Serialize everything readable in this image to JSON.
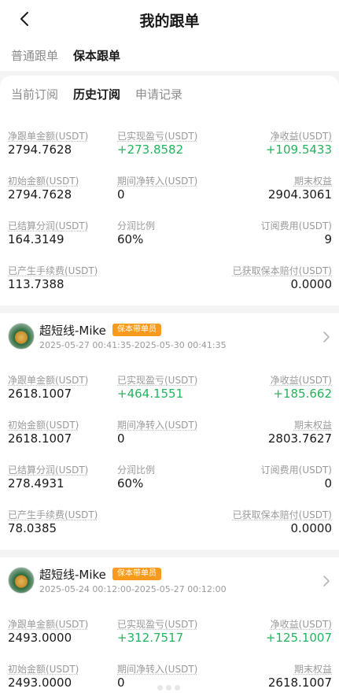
{
  "header": {
    "title": "我的跟单",
    "back_icon": "chevron-left-icon"
  },
  "segments": [
    "普通跟单",
    "保本跟单"
  ],
  "tabs": [
    "当前订阅",
    "历史订阅",
    "申请记录"
  ],
  "colors": {
    "green": "#23b45e",
    "badge": "#f79a1e"
  },
  "records": [
    {
      "stats": [
        [
          {
            "label": "净跟单金额(USDT)",
            "value": "2794.7628"
          },
          {
            "label": "已实现盈亏(USDT)",
            "value": "+273.8582"
          },
          {
            "label": "净收益(USDT)",
            "value": "+109.5433"
          }
        ],
        [
          {
            "label": "初始金额(USDT)",
            "value": "2794.7628"
          },
          {
            "label": "期间净转入(USDT)",
            "value": "0"
          },
          {
            "label": "期末权益",
            "value": "2904.3061"
          }
        ],
        [
          {
            "label": "已结算分润(USDT)",
            "value": "164.3149"
          },
          {
            "label": "分润比例",
            "value": "60%"
          },
          {
            "label": "订阅费用(USDT)",
            "value": "9"
          }
        ],
        [
          {
            "label": "已产生手续费(USDT)",
            "value": "113.7388"
          },
          {
            "label": "已获取保本赔付(USDT)",
            "value": "0.0000"
          }
        ]
      ]
    },
    {
      "trader": {
        "name": "超短线-Mike",
        "badge": "保本带单员",
        "time": "2025-05-27 00:41:35-2025-05-30 00:41:35"
      },
      "stats": [
        [
          {
            "label": "净跟单金额(USDT)",
            "value": "2618.1007"
          },
          {
            "label": "已实现盈亏(USDT)",
            "value": "+464.1551"
          },
          {
            "label": "净收益(USDT)",
            "value": "+185.662"
          }
        ],
        [
          {
            "label": "初始金额(USDT)",
            "value": "2618.1007"
          },
          {
            "label": "期间净转入(USDT)",
            "value": "0"
          },
          {
            "label": "期末权益",
            "value": "2803.7627"
          }
        ],
        [
          {
            "label": "已结算分润(USDT)",
            "value": "278.4931"
          },
          {
            "label": "分润比例",
            "value": "60%"
          },
          {
            "label": "订阅费用(USDT)",
            "value": "0"
          }
        ],
        [
          {
            "label": "已产生手续费(USDT)",
            "value": "78.0385"
          },
          {
            "label": "已获取保本赔付(USDT)",
            "value": "0.0000"
          }
        ]
      ]
    },
    {
      "trader": {
        "name": "超短线-Mike",
        "badge": "保本带单员",
        "time": "2025-05-24 00:12:00-2025-05-27 00:12:00"
      },
      "stats": [
        [
          {
            "label": "净跟单金额(USDT)",
            "value": "2493.0000"
          },
          {
            "label": "已实现盈亏(USDT)",
            "value": "+312.7517"
          },
          {
            "label": "净收益(USDT)",
            "value": "+125.1007"
          }
        ],
        [
          {
            "label": "初始金额(USDT)",
            "value": "2493.0000"
          },
          {
            "label": "期间净转入(USDT)",
            "value": "0"
          },
          {
            "label": "期末权益",
            "value": "2618.1007"
          }
        ]
      ]
    }
  ]
}
